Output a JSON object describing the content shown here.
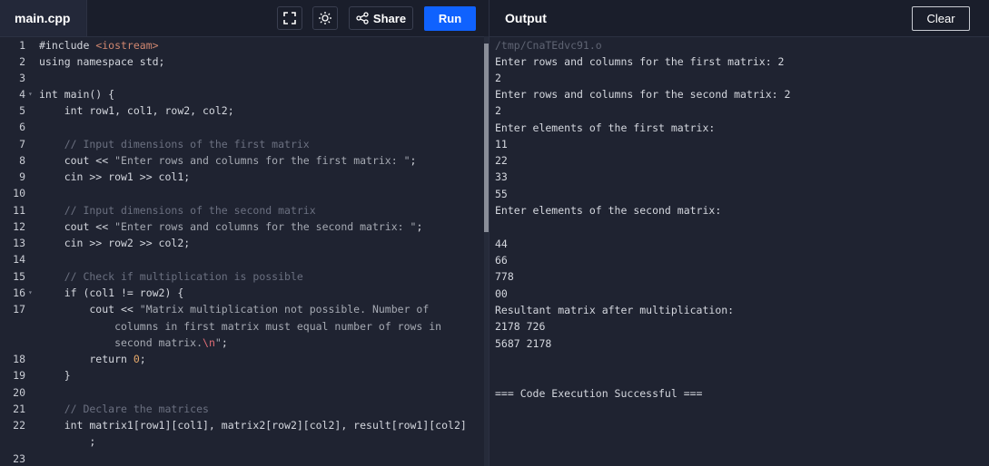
{
  "topbar": {
    "file_tab": "main.cpp",
    "share_label": "Share",
    "run_label": "Run",
    "output_title": "Output",
    "clear_label": "Clear"
  },
  "editor": {
    "line_numbers": [
      "1",
      "2",
      "3",
      "4",
      "5",
      "6",
      "7",
      "8",
      "9",
      "10",
      "11",
      "12",
      "13",
      "14",
      "15",
      "16",
      "17",
      "",
      "",
      "18",
      "19",
      "20",
      "21",
      "22",
      "",
      "23"
    ],
    "lines": {
      "l1_a": "#include ",
      "l1_b": "<iostream>",
      "l2": "using namespace std;",
      "l4": "int main() {",
      "l5": "    int row1, col1, row2, col2;",
      "l7": "    // Input dimensions of the first matrix",
      "l8_a": "    cout << ",
      "l8_b": "\"Enter rows and columns for the first matrix: \"",
      "l8_c": ";",
      "l9": "    cin >> row1 >> col1;",
      "l11": "    // Input dimensions of the second matrix",
      "l12_a": "    cout << ",
      "l12_b": "\"Enter rows and columns for the second matrix: \"",
      "l12_c": ";",
      "l13": "    cin >> row2 >> col2;",
      "l15": "    // Check if multiplication is possible",
      "l16": "    if (col1 != row2) {",
      "l17_a": "        cout << ",
      "l17_b": "\"Matrix multiplication not possible. Number of",
      "l17w1": "            columns in first matrix must equal number of rows in",
      "l17w2_a": "            second matrix.",
      "l17w2_b": "\\n",
      "l17w2_c": "\"",
      "l17w2_d": ";",
      "l18_a": "        return ",
      "l18_b": "0",
      "l18_c": ";",
      "l19": "    }",
      "l21": "    // Declare the matrices",
      "l22": "    int matrix1[row1][col1], matrix2[row2][col2], result[row1][col2]",
      "l22w": "        ;"
    }
  },
  "output": {
    "lines": [
      "/tmp/CnaTEdvc91.o",
      "Enter rows and columns for the first matrix: 2",
      "2",
      "Enter rows and columns for the second matrix: 2",
      "2",
      "Enter elements of the first matrix:",
      "11",
      "22",
      "33",
      "55",
      "Enter elements of the second matrix:",
      "",
      "44",
      "66",
      "778",
      "00",
      "Resultant matrix after multiplication:",
      "2178 726",
      "5687 2178",
      "",
      "",
      "=== Code Execution Successful ==="
    ]
  },
  "colors": {
    "run_button": "#0f62fe",
    "background": "#1f2331",
    "topbar": "#1a1e2b"
  },
  "icons": [
    "fullscreen-icon",
    "sun-icon",
    "share-icon",
    "fold-arrow-icon"
  ]
}
